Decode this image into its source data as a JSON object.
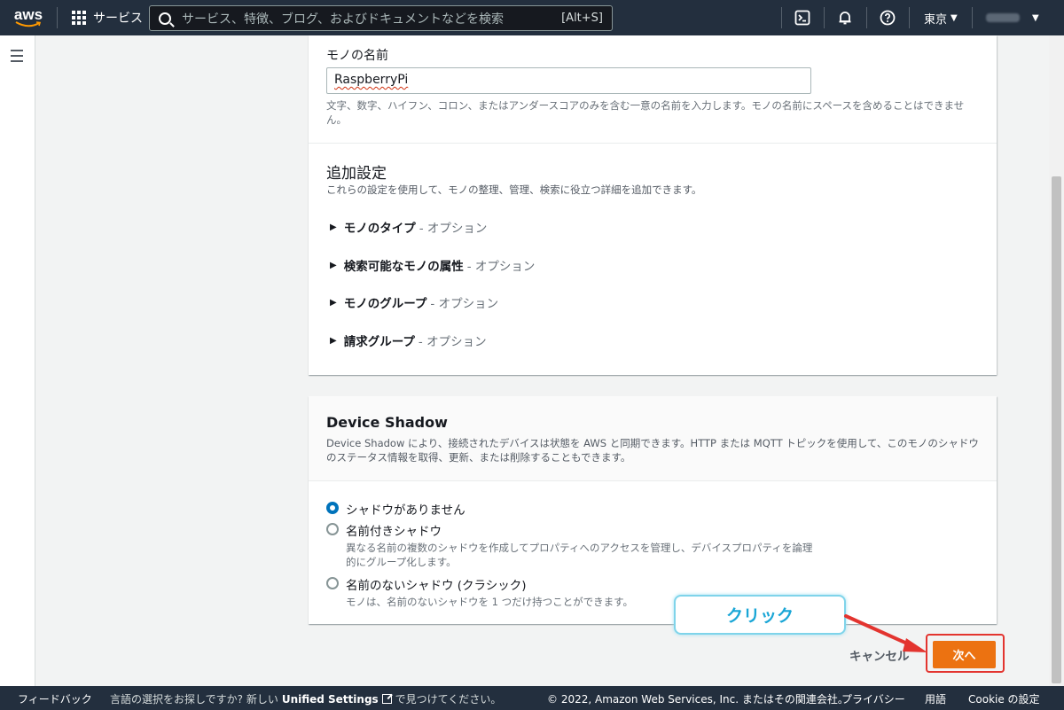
{
  "nav": {
    "logo_text": "aws",
    "services_label": "サービス",
    "search_placeholder": "サービス、特徴、ブログ、およびドキュメントなどを検索",
    "search_shortcut": "[Alt+S]",
    "region": "東京"
  },
  "thing_name": {
    "label": "モノの名前",
    "value": "RaspberryPi",
    "hint": "文字、数字、ハイフン、コロン、またはアンダースコアのみを含む一意の名前を入力します。モノの名前にスペースを含めることはできません。"
  },
  "additional": {
    "title": "追加設定",
    "description": "これらの設定を使用して、モノの整理、管理、検索に役立つ詳細を追加できます。",
    "items": [
      {
        "label": "モノのタイプ",
        "suffix": "- オプション"
      },
      {
        "label": "検索可能なモノの属性",
        "suffix": "- オプション"
      },
      {
        "label": "モノのグループ",
        "suffix": "- オプション"
      },
      {
        "label": "請求グループ",
        "suffix": "- オプション"
      }
    ]
  },
  "shadow": {
    "title": "Device Shadow",
    "description": "Device Shadow により、接続されたデバイスは状態を AWS と同期できます。HTTP または MQTT トピックを使用して、このモノのシャドウのステータス情報を取得、更新、または削除することもできます。",
    "options": [
      {
        "label": "シャドウがありません",
        "desc": "",
        "selected": true
      },
      {
        "label": "名前付きシャドウ",
        "desc": "異なる名前の複数のシャドウを作成してプロパティへのアクセスを管理し、デバイスプロパティを論理的にグループ化します。",
        "selected": false
      },
      {
        "label": "名前のないシャドウ (クラシック)",
        "desc": "モノは、名前のないシャドウを 1 つだけ持つことができます。",
        "selected": false
      }
    ]
  },
  "actions": {
    "cancel": "キャンセル",
    "next": "次へ"
  },
  "annotation": {
    "callout": "クリック",
    "color": "#e3342f"
  },
  "footer": {
    "feedback": "フィードバック",
    "msg_prefix": "言語の選択をお探しですか? 新しい",
    "msg_link": "Unified Settings",
    "msg_suffix": "で見つけてください。",
    "copyright": "© 2022, Amazon Web Services, Inc. またはその関連会社。",
    "privacy": "プライバシー",
    "terms": "用語",
    "cookie": "Cookie の設定"
  },
  "colors": {
    "nav_bg": "#232f3e",
    "primary_button": "#ec7211",
    "radio_selected": "#0073bb"
  }
}
